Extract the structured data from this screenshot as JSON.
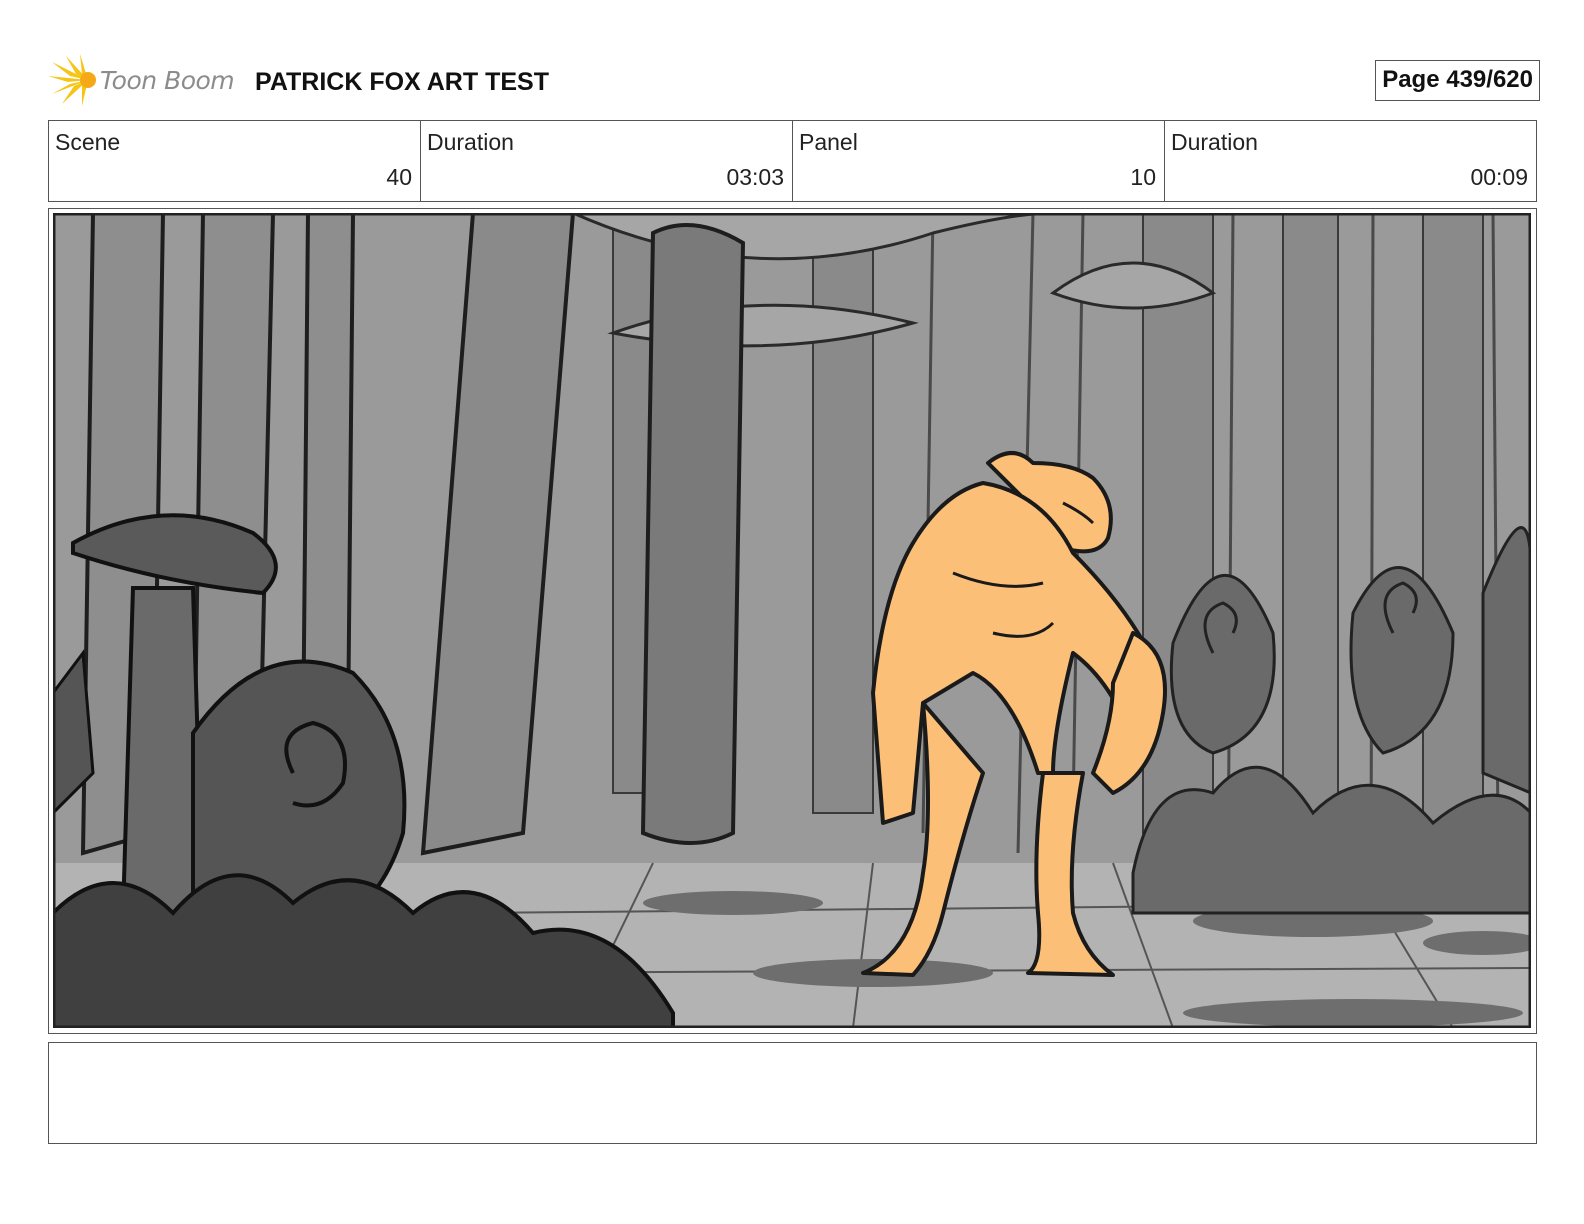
{
  "header": {
    "logo_text": "Toon Boom",
    "title": "PATRICK FOX ART TEST",
    "page_label": "Page 439/620"
  },
  "info": [
    {
      "label": "Scene",
      "value": "40"
    },
    {
      "label": "Duration",
      "value": "03:03"
    },
    {
      "label": "Panel",
      "value": "10"
    },
    {
      "label": "Duration",
      "value": "00:09"
    }
  ],
  "notes": "",
  "colors": {
    "logo_burst": "#f5c518",
    "character_fill": "#fbbf77",
    "background_gray": "#9a9a9a"
  },
  "icons": [
    "toon-boom-logo-icon"
  ]
}
